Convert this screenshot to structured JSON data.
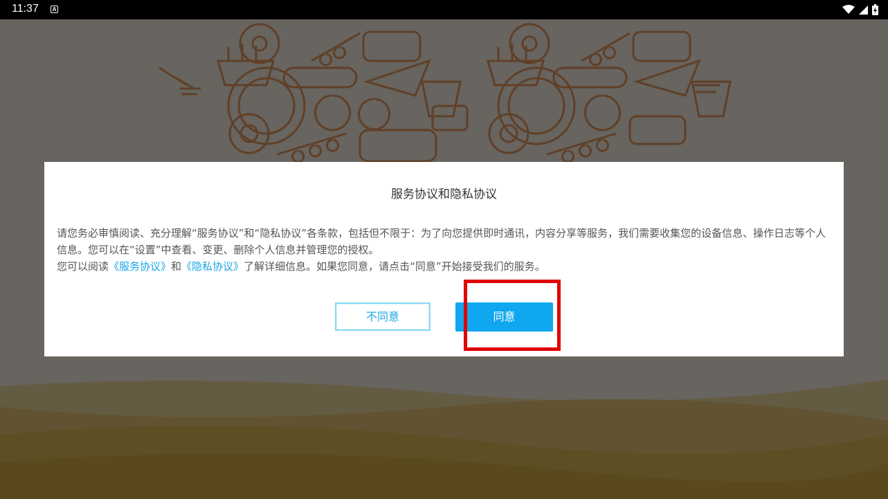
{
  "status_bar": {
    "time": "11:37",
    "notification_icon": "a-box-icon",
    "icons": [
      "wifi-icon",
      "cell-signal-icon",
      "battery-icon"
    ]
  },
  "dialog": {
    "title": "服务协议和隐私协议",
    "paragraph1": "请您务必审慎阅读、充分理解“服务协议”和“隐私协议”各条款，包括但不限于：为了向您提供即时通讯，内容分享等服务，我们需要收集您的设备信息、操作日志等个人信息。您可以在“设置”中查看、变更、删除个人信息并管理您的授权。",
    "p2_prefix": " 您可以阅读",
    "link_service": "《服务协议》",
    "p2_and": "和",
    "link_privacy": "《隐私协议》",
    "p2_suffix": "了解详细信息。如果您同意，请点击“同意”开始接受我们的服务。",
    "disagree_label": "不同意",
    "agree_label": "同意"
  },
  "colors": {
    "accent": "#0fa7ef",
    "link": "#1aa6e8",
    "highlight": "#e00000",
    "illustration": "#e08a4a",
    "waves": "#d9b54a"
  }
}
